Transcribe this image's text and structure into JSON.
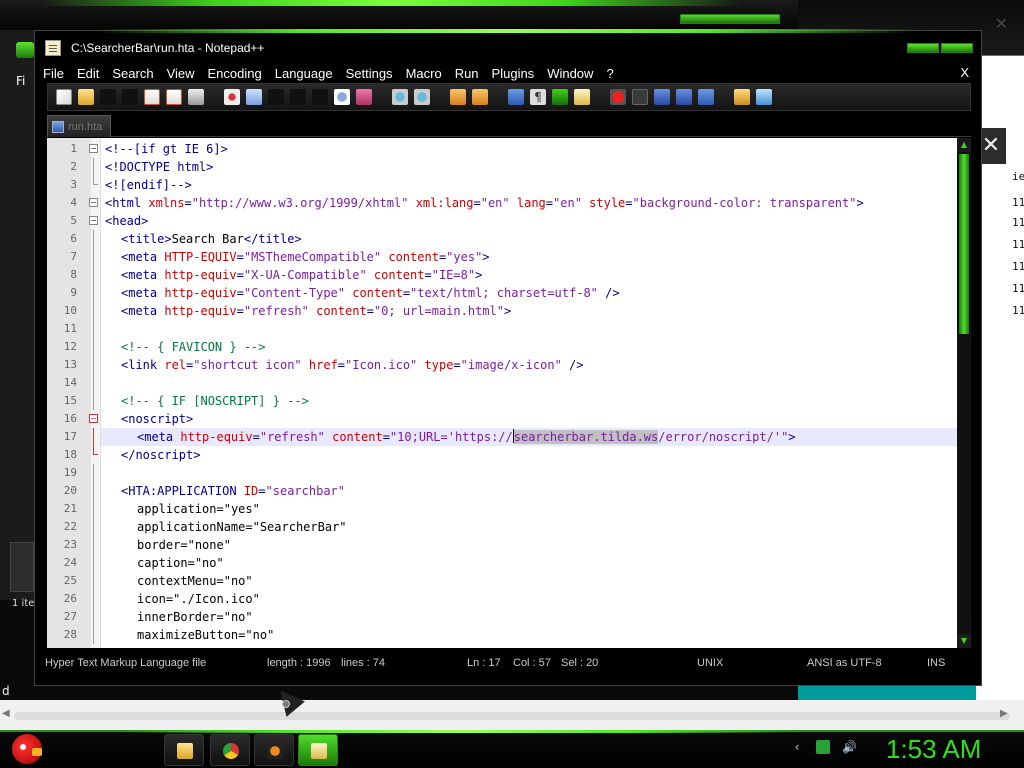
{
  "window": {
    "title": "C:\\SearcherBar\\run.hta - Notepad++"
  },
  "menu": {
    "items": [
      "File",
      "Edit",
      "Search",
      "View",
      "Encoding",
      "Language",
      "Settings",
      "Macro",
      "Run",
      "Plugins",
      "Window",
      "?"
    ],
    "close": "X"
  },
  "toolbar": {
    "icons": [
      "new-file-icon",
      "open-file-icon",
      "save-icon",
      "save-all-icon",
      "close-icon",
      "close-all-icon",
      "print-icon",
      "cut-icon",
      "copy-icon",
      "paste-icon",
      "undo-icon",
      "redo-icon",
      "find-icon",
      "replace-icon",
      "zoom-in-icon",
      "zoom-out-icon",
      "sync-vertical-icon",
      "sync-horizontal-icon",
      "word-wrap-icon",
      "show-all-chars-icon",
      "indent-guide-icon",
      "doc-map-icon",
      "record-macro-icon",
      "stop-macro-icon",
      "play-macro-icon",
      "play-multiple-icon",
      "save-macro-icon",
      "folder-workspace-icon",
      "spell-check-icon"
    ]
  },
  "tabs": [
    {
      "label": "run.hta",
      "icon": "file-tab-icon"
    }
  ],
  "editor": {
    "current_line": 17,
    "lines": [
      {
        "n": "1",
        "text": "<!--[if gt IE 6]>"
      },
      {
        "n": "2",
        "text": "<!DOCTYPE html>"
      },
      {
        "n": "3",
        "text": "<![endif]-->"
      },
      {
        "n": "4",
        "text": "<html xmlns=\"http://www.w3.org/1999/xhtml\" xml:lang=\"en\" lang=\"en\" style=\"background-color: transparent\">"
      },
      {
        "n": "5",
        "text": "<head>"
      },
      {
        "n": "6",
        "text": "<title>Search Bar</title>"
      },
      {
        "n": "7",
        "text": "<meta HTTP-EQUIV=\"MSThemeCompatible\" content=\"yes\">"
      },
      {
        "n": "8",
        "text": "<meta http-equiv=\"X-UA-Compatible\" content=\"IE=8\">"
      },
      {
        "n": "9",
        "text": "<meta http-equiv=\"Content-Type\" content=\"text/html; charset=utf-8\" />"
      },
      {
        "n": "10",
        "text": "<meta http-equiv=\"refresh\" content=\"0; url=main.html\">"
      },
      {
        "n": "11",
        "text": ""
      },
      {
        "n": "12",
        "text": "<!-- { FAVICON } -->"
      },
      {
        "n": "13",
        "text": "<link rel=\"shortcut icon\" href=\"Icon.ico\" type=\"image/x-icon\" />"
      },
      {
        "n": "14",
        "text": ""
      },
      {
        "n": "15",
        "text": "<!-- { IF [NOSCRIPT] } -->"
      },
      {
        "n": "16",
        "text": "<noscript>"
      },
      {
        "n": "17",
        "text": "<meta http-equiv=\"refresh\" content=\"10;URL='https://searcherbar.tilda.ws/error/noscript/'\">"
      },
      {
        "n": "18",
        "text": "</noscript>"
      },
      {
        "n": "19",
        "text": ""
      },
      {
        "n": "20",
        "text": "<HTA:APPLICATION ID=\"searchbar\""
      },
      {
        "n": "21",
        "text": "application=\"yes\""
      },
      {
        "n": "22",
        "text": "applicationName=\"SearcherBar\""
      },
      {
        "n": "23",
        "text": "border=\"none\""
      },
      {
        "n": "24",
        "text": "caption=\"no\""
      },
      {
        "n": "25",
        "text": "contextMenu=\"no\""
      },
      {
        "n": "26",
        "text": "icon=\"./Icon.ico\""
      },
      {
        "n": "27",
        "text": "innerBorder=\"no\""
      },
      {
        "n": "28",
        "text": "maximizeButton=\"no\""
      }
    ],
    "selection": "searcherbar.tilda.ws"
  },
  "status": {
    "language": "Hyper Text Markup Language file",
    "length": "length : 1996",
    "lines": "lines : 74",
    "ln": "Ln : 17",
    "col": "Col : 57",
    "sel": "Sel : 20",
    "eol": "UNIX",
    "encoding": "ANSI as UTF-8",
    "mode": "INS"
  },
  "background": {
    "left_window_label": "Fi",
    "left_window_items": "1 ite",
    "right_edge_numbers": [
      "11",
      "11",
      "11",
      "11",
      "11",
      "11"
    ],
    "right_edge_text": "ie",
    "bottom_left_char": "d"
  },
  "taskbar": {
    "buttons": [
      "explorer-icon",
      "chrome-icon",
      "search-app-icon",
      "notepadpp-icon"
    ],
    "tray": [
      "tray-chevron-icon",
      "network-icon",
      "volume-icon"
    ],
    "clock": "1:53 AM"
  },
  "colors": {
    "accent": "#3fd31c",
    "clock": "#2ee01a",
    "tag": "#00008b",
    "attribute": "#c00000",
    "string": "#7a1fa2",
    "comment": "#007a3d"
  }
}
